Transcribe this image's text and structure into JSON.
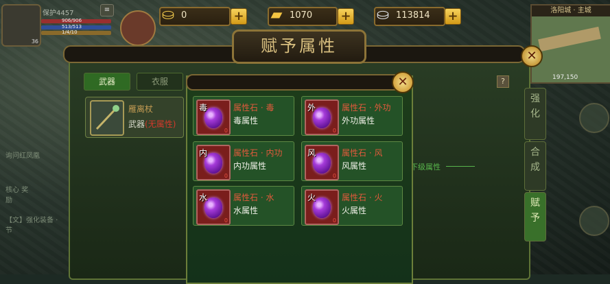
{
  "hud": {
    "player_name": "保护4457",
    "level": "36",
    "bar_hp": "906/906",
    "bar_mp": "513/513",
    "bar_exp": "1/4/10"
  },
  "currencies": [
    {
      "name": "silver-ingot",
      "icon": "ingot-icon",
      "value": "0"
    },
    {
      "name": "gold-bar",
      "icon": "gold-bar-icon",
      "value": "1070"
    },
    {
      "name": "silver-coin",
      "icon": "silver-ingot-icon",
      "value": "113814"
    }
  ],
  "minimap": {
    "title": "洛阳城 · 主城",
    "coords": "197,150"
  },
  "left_panel": {
    "chat_1": "询问红凤凰",
    "chat_2": "核心 奖励",
    "chat_3": "【文】强化装备 · 节"
  },
  "dialog": {
    "title": "赋予属性",
    "tabs": [
      "武器",
      "衣服"
    ],
    "help_label": "?",
    "equipment": {
      "name": "雁离杖",
      "category": "武器",
      "paren_open": "(",
      "attr_status": "无属性",
      "paren_close": ")"
    },
    "hint": "下级属性"
  },
  "side_tabs": [
    {
      "label": [
        "强",
        "化"
      ]
    },
    {
      "label": [
        "合",
        "成"
      ]
    },
    {
      "label": [
        "赋",
        "予"
      ]
    }
  ],
  "popup": {
    "items": [
      {
        "tag": "毒",
        "name": "属性石 · 毒",
        "type": "毒属性",
        "count": "0"
      },
      {
        "tag": "外",
        "name": "属性石 · 外功",
        "type": "外功属性",
        "count": "0"
      },
      {
        "tag": "内",
        "name": "属性石 · 内功",
        "type": "内功属性",
        "count": "0"
      },
      {
        "tag": "风",
        "name": "属性石 · 风",
        "type": "风属性",
        "count": "0"
      },
      {
        "tag": "水",
        "name": "属性石 · 水",
        "type": "水属性",
        "count": "0"
      },
      {
        "tag": "火",
        "name": "属性石 · 火",
        "type": "火属性",
        "count": "0"
      }
    ]
  },
  "colors": {
    "item_name": "#e25a3c",
    "accent_gold": "#d8bf7f",
    "panel_green": "#245227"
  }
}
